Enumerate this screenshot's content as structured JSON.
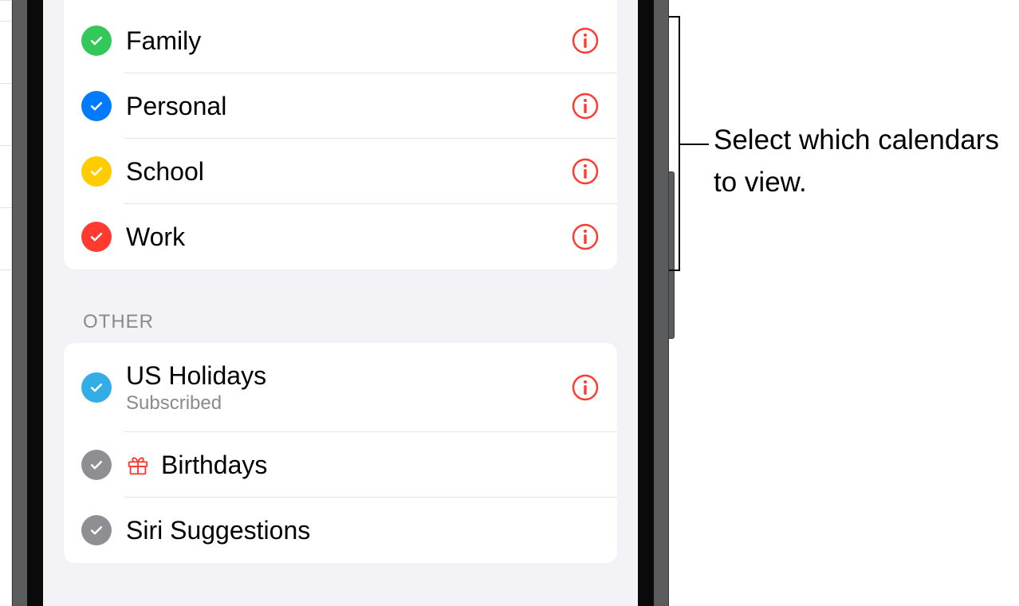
{
  "calendars_main": [
    {
      "label": "Family",
      "color": "#34c759",
      "has_info": true
    },
    {
      "label": "Personal",
      "color": "#007aff",
      "has_info": true
    },
    {
      "label": "School",
      "color": "#ffcc00",
      "has_info": true
    },
    {
      "label": "Work",
      "color": "#ff3b30",
      "has_info": true
    }
  ],
  "section_other_title": "OTHER",
  "calendars_other": [
    {
      "label": "US Holidays",
      "sublabel": "Subscribed",
      "color": "#32ade6",
      "has_info": true,
      "icon": null
    },
    {
      "label": "Birthdays",
      "sublabel": null,
      "color": "#8e8e93",
      "has_info": false,
      "icon": "gift"
    },
    {
      "label": "Siri Suggestions",
      "sublabel": null,
      "color": "#8e8e93",
      "has_info": false,
      "icon": null
    }
  ],
  "info_color": "#ff3b30",
  "annotation": {
    "text": "Select which calendars to view."
  }
}
